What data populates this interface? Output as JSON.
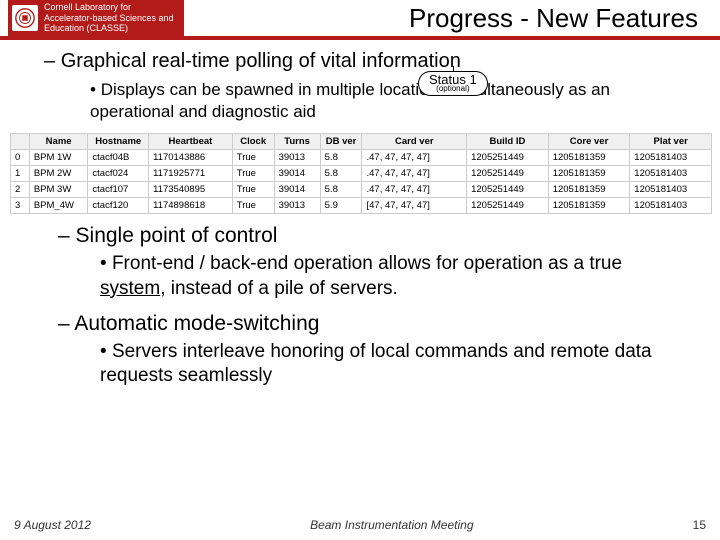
{
  "header": {
    "org_line1": "Cornell Laboratory for",
    "org_line2": "Accelerator-based Sciences and",
    "org_line3": "Education (CLASSE)",
    "title": "Progress - New Features"
  },
  "bullets": {
    "b1": "Graphical real-time polling of vital information",
    "b1a": "Displays can be spawned in multiple locations simultaneously as an operational and diagnostic aid",
    "b2": "Single point of control",
    "b2a_pre": "Front-end / back-end operation allows for operation as a true ",
    "b2a_u": "system",
    "b2a_post": ", instead of a pile of servers.",
    "b3": "Automatic mode-switching",
    "b3a": "Servers interleave honoring of local commands and remote data requests seamlessly"
  },
  "badge": {
    "label": "Status 1",
    "sub": "(optional)"
  },
  "table": {
    "headers": [
      "",
      "Name",
      "Hostname",
      "Heartbeat",
      "Clock",
      "Turns",
      "DB ver",
      "Card ver",
      "Build ID",
      "Core ver",
      "Plat ver"
    ],
    "rows": [
      [
        "0",
        "BPM 1W",
        "ctacf04B",
        "1170143886",
        "True",
        "39013",
        "5.8",
        ".47, 47, 47, 47]",
        "1205251449",
        "1205181359",
        "1205181403"
      ],
      [
        "1",
        "BPM 2W",
        "ctacf024",
        "1171925771",
        "True",
        "39014",
        "5.8",
        ".47, 47, 47, 47]",
        "1205251449",
        "1205181359",
        "1205181403"
      ],
      [
        "2",
        "BPM 3W",
        "ctacf107",
        "1173540895",
        "True",
        "39014",
        "5.8",
        ".47, 47, 47, 47]",
        "1205251449",
        "1205181359",
        "1205181403"
      ],
      [
        "3",
        "BPM_4W",
        "ctacf120",
        "1174898618",
        "True",
        "39013",
        "5.9",
        "[47, 47, 47, 47]",
        "1205251449",
        "1205181359",
        "1205181403"
      ]
    ]
  },
  "footer": {
    "date": "9 August 2012",
    "venue": "Beam Instrumentation Meeting",
    "page": "15"
  }
}
